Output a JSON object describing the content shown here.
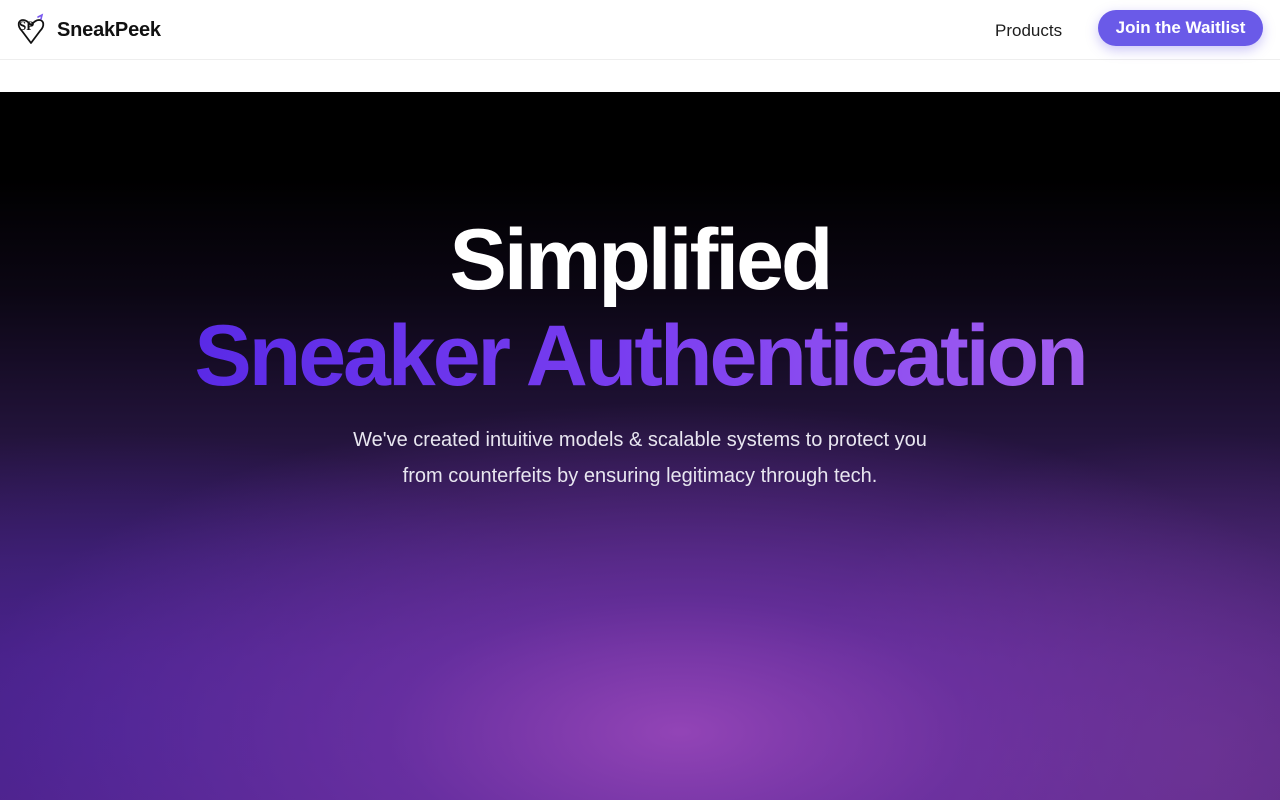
{
  "navbar": {
    "brand_name": "SneakPeek",
    "logo_icon": "sp-heart-logo-icon",
    "links": [
      {
        "label": "Products"
      }
    ],
    "cta_label": "Join the Waitlist"
  },
  "hero": {
    "headline_line1": "Simplified",
    "headline_line2": "Sneaker Authentication",
    "subtitle_line1": "We've created intuitive models & scalable systems to protect you",
    "subtitle_line2": "from counterfeits by ensuring legitimacy through tech."
  },
  "colors": {
    "accent": "#6a5ae8",
    "headline_gradient_start": "#5a2ae6",
    "headline_gradient_end": "#a35ff0",
    "hero_background_top": "#000000",
    "hero_glow": "#9646b9"
  }
}
